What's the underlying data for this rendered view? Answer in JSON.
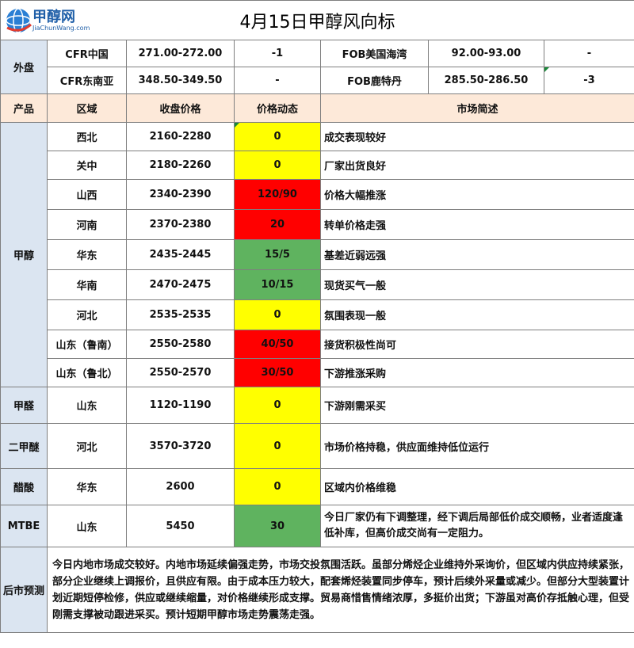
{
  "logo": {
    "brand_cn": "甲醇网",
    "brand_en": "JiaChunWang.com",
    "icon": "globe-logo-icon"
  },
  "title": "4月15日甲醇风向标",
  "external": {
    "label": "外盘",
    "rows": [
      {
        "a_name": "CFR中国",
        "a_price": "271.00-272.00",
        "a_change": "-1",
        "b_name": "FOB美国海湾",
        "b_price": "92.00-93.00",
        "b_change": "-"
      },
      {
        "a_name": "CFR东南亚",
        "a_price": "348.50-349.50",
        "a_change": "-",
        "b_name": "FOB鹿特丹",
        "b_price": "285.50-286.50",
        "b_change": "-3"
      }
    ]
  },
  "headers": {
    "product": "产品",
    "region": "区域",
    "close": "收盘价格",
    "dynamic": "价格动态",
    "summary": "市场简述"
  },
  "methanol": {
    "label": "甲醇",
    "rows": [
      {
        "region": "西北",
        "price": "2160-2280",
        "change": "0",
        "status": "yellow",
        "note": "成交表现较好"
      },
      {
        "region": "关中",
        "price": "2180-2260",
        "change": "0",
        "status": "yellow",
        "note": "厂家出货良好"
      },
      {
        "region": "山西",
        "price": "2340-2390",
        "change": "120/90",
        "status": "red",
        "note": "价格大幅推涨"
      },
      {
        "region": "河南",
        "price": "2370-2380",
        "change": "20",
        "status": "red",
        "note": "转单价格走强"
      },
      {
        "region": "华东",
        "price": "2435-2445",
        "change": "15/5",
        "status": "green",
        "note": "基差近弱远强"
      },
      {
        "region": "华南",
        "price": "2470-2475",
        "change": "10/15",
        "status": "green",
        "note": "现货买气一般"
      },
      {
        "region": "河北",
        "price": "2535-2535",
        "change": "0",
        "status": "yellow",
        "note": "氛围表现一般"
      },
      {
        "region": "山东（鲁南）",
        "price": "2550-2580",
        "change": "40/50",
        "status": "red",
        "note": "接货积极性尚可"
      },
      {
        "region": "山东（鲁北）",
        "price": "2550-2570",
        "change": "30/50",
        "status": "red",
        "note": "下游推涨采购"
      }
    ]
  },
  "others": [
    {
      "product": "甲醛",
      "region": "山东",
      "price": "1120-1190",
      "change": "0",
      "status": "yellow",
      "note": "下游刚需采买"
    },
    {
      "product": "二甲醚",
      "region": "河北",
      "price": "3570-3720",
      "change": "0",
      "status": "yellow",
      "note": "市场价格持稳，供应面维持低位运行"
    },
    {
      "product": "醋酸",
      "region": "华东",
      "price": "2600",
      "change": "0",
      "status": "yellow",
      "note": "区域内价格维稳"
    },
    {
      "product": "MTBE",
      "region": "山东",
      "price": "5450",
      "change": "30",
      "status": "green",
      "note": "今日厂家仍有下调整理，经下调后局部低价成交顺畅，业者适度逢低补库，但高价成交尚有一定阻力。"
    }
  ],
  "forecast": {
    "label": "后市预测",
    "text": "今日内地市场成交较好。内地市场延续偏强走势，市场交投氛围活跃。虽部分烯烃企业维持外采询价，但区域内供应持续紧张，部分企业继续上调报价，且供应有限。由于成本压力较大，配套烯烃装置同步停车，预计后续外采量或减少。但部分大型装置计划近期短停检修，供应或继续缩量，对价格继续形成支撑。贸易商惜售情绪浓厚，多挺价出货；下游虽对高价存抵触心理，但受刚需支撑被动跟进采买。预计短期甲醇市场走势震荡走强。"
  }
}
